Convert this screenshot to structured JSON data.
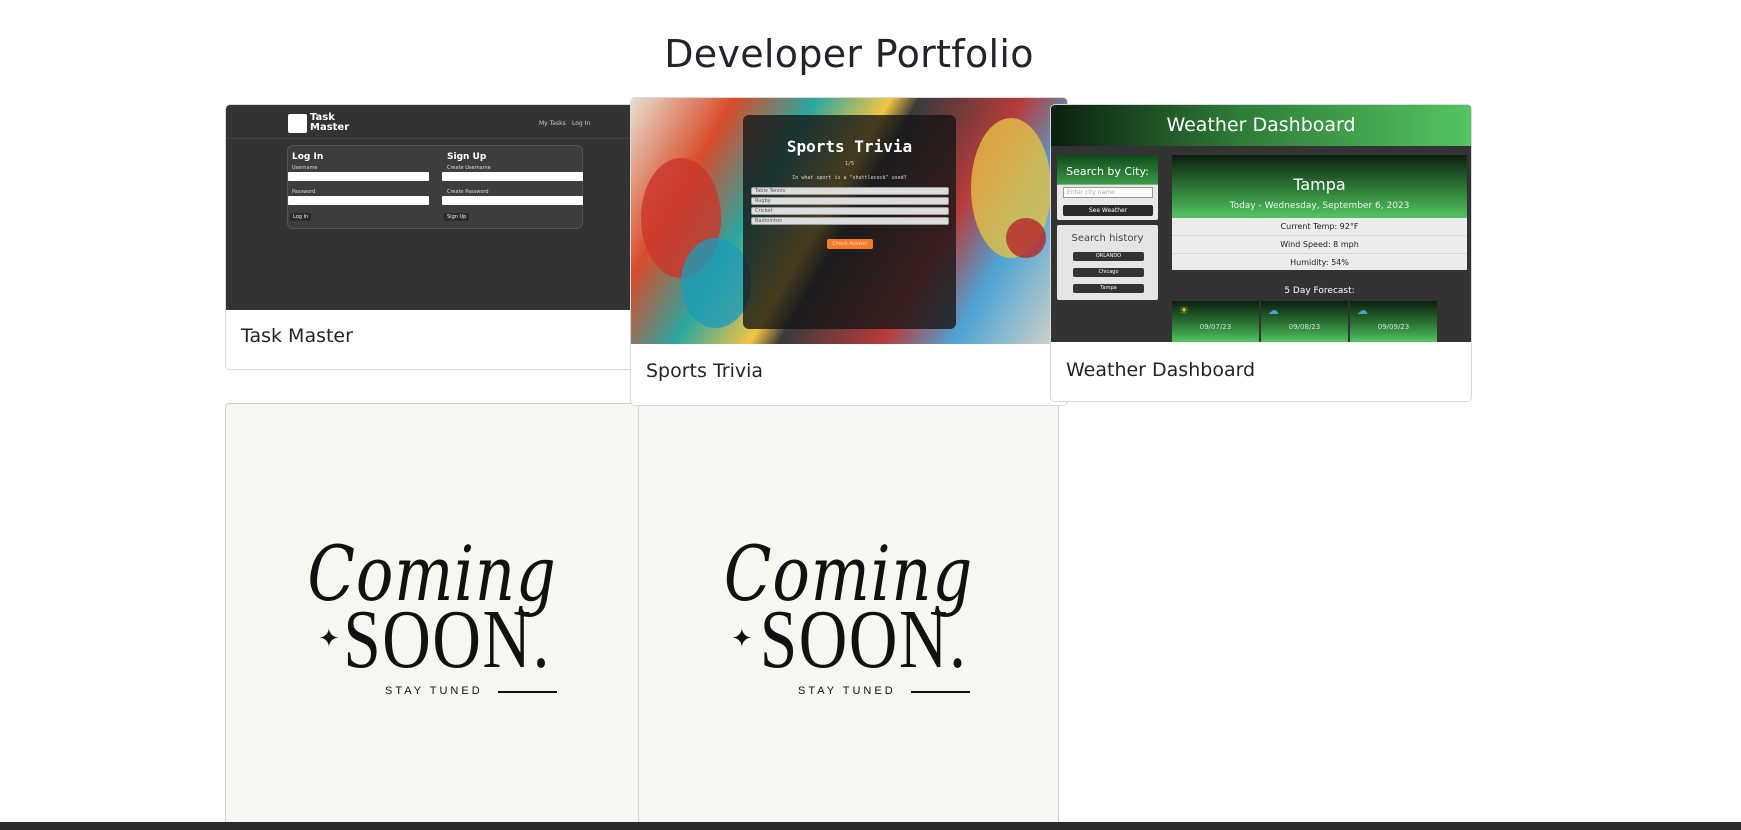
{
  "page": {
    "title": "Developer Portfolio"
  },
  "projects": [
    {
      "title": "Task Master",
      "thumbnail": {
        "logo": "Task Master",
        "nav_links": [
          "My Tasks",
          "Log In"
        ],
        "login_heading": "Log In",
        "signup_heading": "Sign Up",
        "username_label": "Username",
        "password_label": "Password",
        "create_username_label": "Create Username",
        "create_password_label": "Create Password",
        "login_button": "Log In",
        "signup_button": "Sign Up"
      }
    },
    {
      "title": "Sports Trivia",
      "thumbnail": {
        "heading": "Sports Trivia",
        "counter": "1/5",
        "question": "In what sport is a \"shuttlecock\" used?",
        "options": [
          "Table Tennis",
          "Rugby",
          "Cricket",
          "Badminton"
        ],
        "submit": "Check Answer"
      }
    },
    {
      "title": "Weather Dashboard",
      "thumbnail": {
        "header": "Weather Dashboard",
        "search_heading": "Search by City:",
        "search_placeholder": "Enter city name",
        "search_button": "See Weather",
        "history_heading": "Search history",
        "history": [
          "ORLANDO",
          "Chicago",
          "Tampa"
        ],
        "city": "Tampa",
        "date": "Today - Wednesday, September 6, 2023",
        "temp": "Current Temp: 92°F",
        "wind": "Wind Speed: 8 mph",
        "humidity": "Humidity: 54%",
        "forecast_heading": "5 Day Forecast:",
        "forecast_dates": [
          "09/07/23",
          "09/08/23",
          "09/09/23"
        ]
      }
    },
    {
      "coming": "Coming",
      "soon": "SOON.",
      "tagline": "STAY TUNED"
    },
    {
      "coming": "Coming",
      "soon": "SOON.",
      "tagline": "STAY TUNED"
    }
  ],
  "icons": {
    "star": "sparkle-star-icon",
    "forecast": "sun-cloud-icon"
  },
  "colors": {
    "accent_green": "#55c462",
    "dark": "#333333",
    "orange": "#f47c2a"
  }
}
